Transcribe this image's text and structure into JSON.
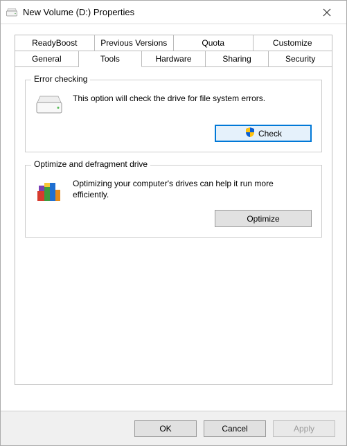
{
  "window": {
    "title": "New Volume (D:) Properties"
  },
  "tabs": {
    "row1": [
      "ReadyBoost",
      "Previous Versions",
      "Quota",
      "Customize"
    ],
    "row2": [
      "General",
      "Tools",
      "Hardware",
      "Sharing",
      "Security"
    ],
    "active": "Tools"
  },
  "errorChecking": {
    "title": "Error checking",
    "description": "This option will check the drive for file system errors.",
    "button": "Check"
  },
  "optimize": {
    "title": "Optimize and defragment drive",
    "description": "Optimizing your computer's drives can help it run more efficiently.",
    "button": "Optimize"
  },
  "footer": {
    "ok": "OK",
    "cancel": "Cancel",
    "apply": "Apply"
  }
}
